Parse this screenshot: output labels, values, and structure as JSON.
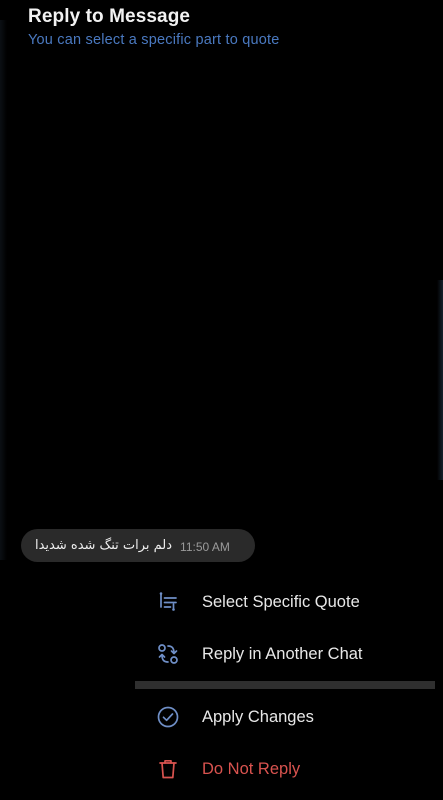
{
  "header": {
    "title": "Reply to Message",
    "subtitle": "You can select a specific part to quote"
  },
  "message": {
    "text": "دلم برات تنگ شده شدیدا",
    "time": "11:50 AM"
  },
  "menu": {
    "group1": [
      {
        "label": "Select Specific Quote",
        "icon": "quote-select-icon"
      },
      {
        "label": "Reply in Another Chat",
        "icon": "swap-arrows-icon"
      }
    ],
    "group2": [
      {
        "label": "Apply Changes",
        "icon": "check-circle-icon"
      },
      {
        "label": "Do Not Reply",
        "icon": "trash-icon"
      }
    ]
  },
  "colors": {
    "background": "#000000",
    "accent": "#4a79c0",
    "danger": "#d9534f",
    "bubble": "#2a2a2a"
  }
}
